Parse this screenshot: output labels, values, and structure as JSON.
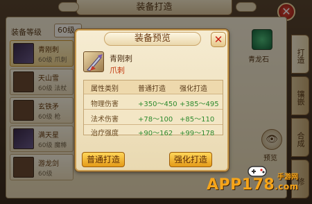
{
  "background": {
    "window_title": "装备打造",
    "filter_label": "装备等级",
    "filter_value": "60级",
    "items": [
      {
        "name": "青刚刺",
        "level": "60级",
        "type": "爪刺",
        "selected": true,
        "thumb": "weapon"
      },
      {
        "name": "天山雪",
        "level": "60级",
        "type": "法杖",
        "selected": false,
        "thumb": "plain"
      },
      {
        "name": "玄铁矛",
        "level": "60级",
        "type": "枪",
        "selected": false,
        "thumb": "plain"
      },
      {
        "name": "满天星",
        "level": "60级",
        "type": "魔棒",
        "selected": false,
        "thumb": "weapon"
      },
      {
        "name": "游龙剑",
        "level": "60级",
        "type": "",
        "selected": false,
        "thumb": "plain"
      }
    ],
    "side_tabs": [
      "打造",
      "镶嵌",
      "合成",
      "修"
    ],
    "gem_label": "青龙石",
    "preview_label": "预览"
  },
  "modal": {
    "title": "装备预览",
    "item_name": "青刚刺",
    "item_type": "爪刺",
    "table": {
      "headers": [
        "属性类别",
        "普通打造",
        "强化打造"
      ],
      "rows": [
        {
          "name": "物理伤害",
          "normal": "+350～450",
          "strong": "+385～495"
        },
        {
          "name": "法术伤害",
          "normal": "+78～100",
          "strong": "+85～110"
        },
        {
          "name": "治疗强度",
          "normal": "+90～162",
          "strong": "+99～178"
        }
      ]
    },
    "buttons": {
      "normal": "普通打造",
      "strong": "强化打造"
    }
  },
  "watermark": {
    "text": "APP178",
    "suffix": ".com",
    "sub": "手游网"
  }
}
